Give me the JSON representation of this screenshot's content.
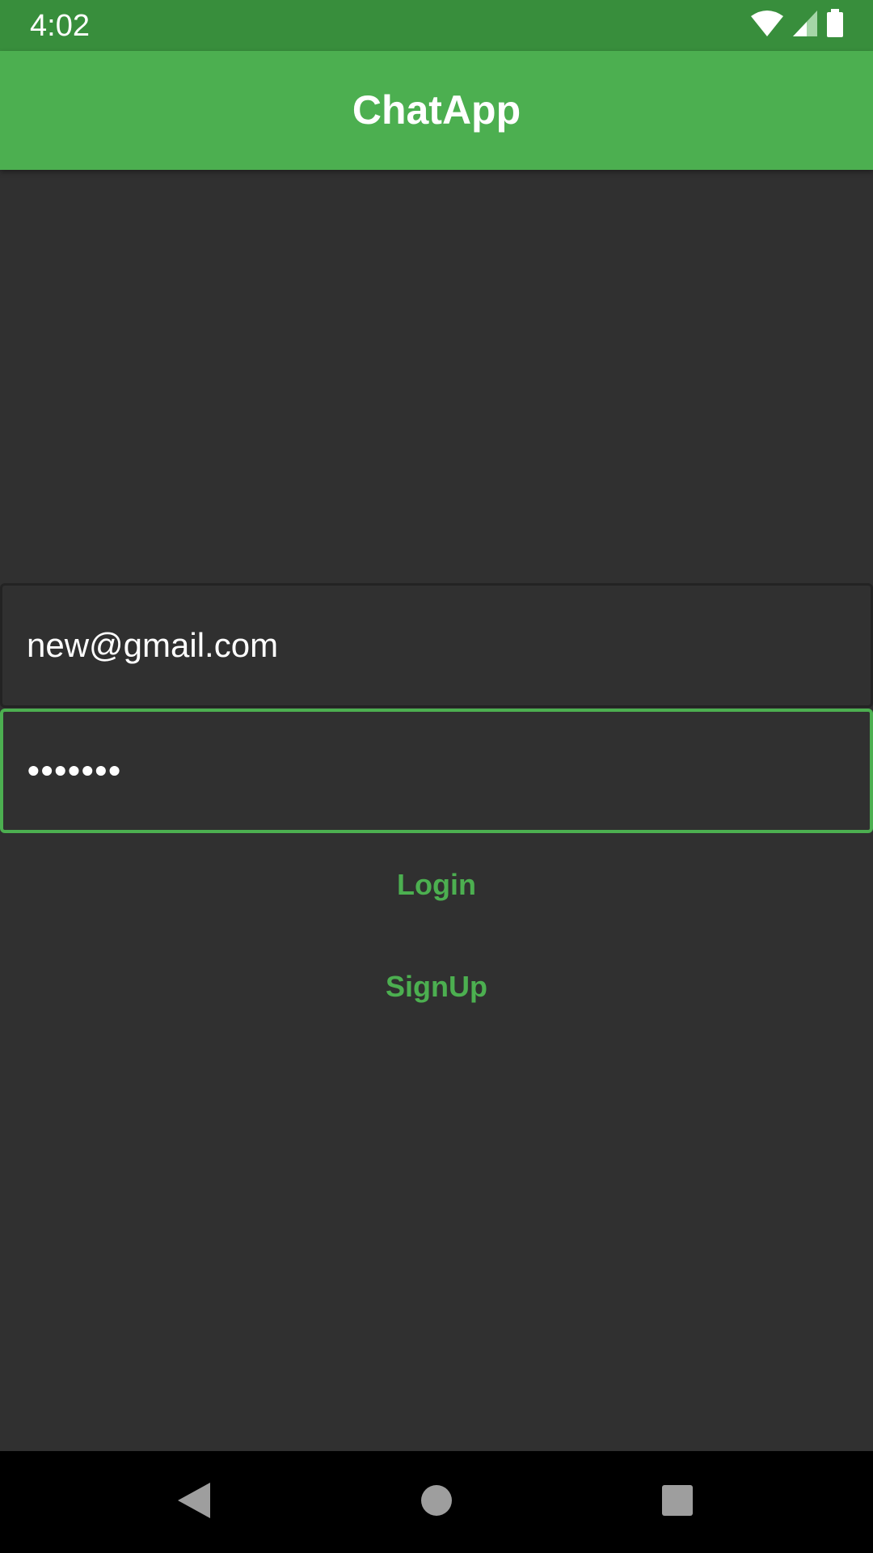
{
  "status_bar": {
    "time": "4:02",
    "icons": [
      "wifi-icon",
      "cell-signal-icon",
      "battery-icon"
    ]
  },
  "app_bar": {
    "title": "ChatApp"
  },
  "form": {
    "email_value": "new@gmail.com",
    "password_value": "•••••••",
    "login_label": "Login",
    "signup_label": "SignUp"
  },
  "nav_bar": {
    "icons": [
      "back-icon",
      "home-icon",
      "recents-icon"
    ]
  },
  "colors": {
    "primary": "#4caf50",
    "primary_dark": "#388e3c",
    "background": "#303030",
    "nav_background": "#000000",
    "text": "#ffffff"
  }
}
